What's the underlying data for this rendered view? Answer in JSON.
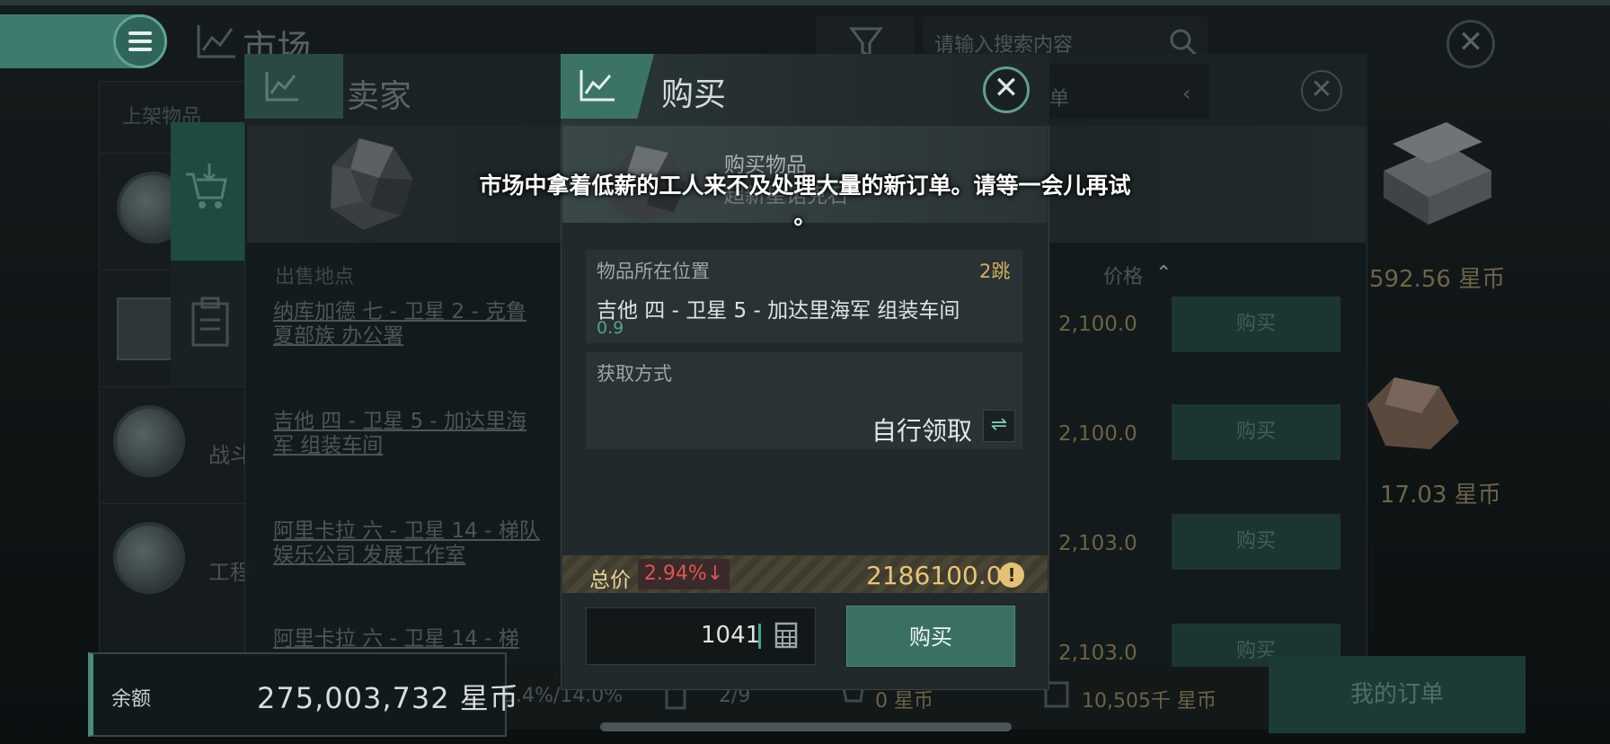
{
  "header": {
    "title": "市场",
    "search_placeholder": "请输入搜索内容"
  },
  "left_list": {
    "tab_label": "上架物品",
    "rows": [
      {
        "label": "战斗"
      },
      {
        "label": "工程"
      }
    ]
  },
  "seller_panel": {
    "title": "卖家",
    "col_location": "出售地点",
    "col_price": "价格",
    "rows": [
      {
        "location": "纳库加德 七 - 卫星 2 - 克鲁夏部族 办公署",
        "price": "2,100.0",
        "buy_label": "购买"
      },
      {
        "location": "吉他 四 - 卫星 5 - 加达里海军 组装车间",
        "price": "2,100.0",
        "buy_label": "购买"
      },
      {
        "location": "阿里卡拉 六 - 卫星 14 - 梯队娱乐公司 发展工作室",
        "price": "2,103.0",
        "buy_label": "购买"
      },
      {
        "location": "阿里卡拉 六 - 卫星 14 - 梯",
        "price": "2,103.0",
        "buy_label": "购买"
      }
    ]
  },
  "order_mini": {
    "label": "单"
  },
  "right_items": [
    {
      "price": "592.56 星币"
    },
    {
      "price": "17.03 星币"
    }
  ],
  "bottom_bar": {
    "balance_label": "余额",
    "balance_value": "275,003,732 星币",
    "ratio": "5.4%/14.0%",
    "slots": "2/9",
    "cart_value": "0 星币",
    "order_value": "10,505千 星币",
    "my_orders": "我的订单"
  },
  "buy_modal": {
    "title": "购买",
    "item_heading": "购买物品",
    "item_name": "超新星诺克石",
    "location_label": "物品所在位置",
    "jumps": "2跳",
    "location_value": "吉他 四 - 卫星 5 - 加达里海军 组装车间",
    "security": "0.9",
    "method_label": "获取方式",
    "method_value": "自行领取",
    "total_label": "总价",
    "change_pct": "2.94%",
    "change_arrow": "↓",
    "total_value": "2186100.0",
    "quantity": "1041",
    "buy_label": "购买"
  },
  "toast": {
    "message_line1": "市场中拿着低薪的工人来不及处理大量的新订单。请等一会儿再试",
    "message_line2": "。"
  },
  "colors": {
    "accent": "#3b7467",
    "gold": "#e9c475",
    "down_red": "#e05454",
    "security_green": "#54a08f"
  },
  "icons": [
    "menu-icon",
    "market-chart-icon",
    "filter-icon",
    "search-icon",
    "close-icon",
    "cart-icon",
    "clipboard-icon",
    "calculator-icon",
    "swap-icon",
    "warning-icon",
    "caret-up-icon"
  ]
}
